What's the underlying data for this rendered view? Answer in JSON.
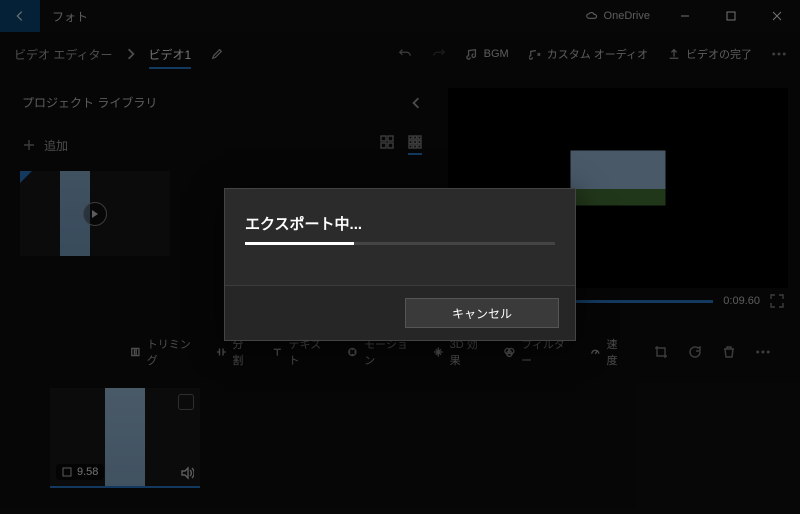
{
  "titlebar": {
    "app_name": "フォト",
    "onedrive": "OneDrive"
  },
  "breadcrumb": {
    "editor": "ビデオ エディター",
    "project": "ビデオ1"
  },
  "header_actions": {
    "bgm": "BGM",
    "custom_audio": "カスタム オーディオ",
    "finish": "ビデオの完了"
  },
  "library": {
    "title": "プロジェクト ライブラリ",
    "add": "追加"
  },
  "preview": {
    "duration": "0:09.60"
  },
  "toolbar": {
    "trim": "トリミング",
    "split": "分割",
    "text": "テキスト",
    "motion": "モーション",
    "effect3d": "3D 効果",
    "filter": "フィルター",
    "speed": "速度"
  },
  "clip": {
    "duration": "9.58"
  },
  "dialog": {
    "title": "エクスポート中...",
    "cancel": "キャンセル"
  }
}
